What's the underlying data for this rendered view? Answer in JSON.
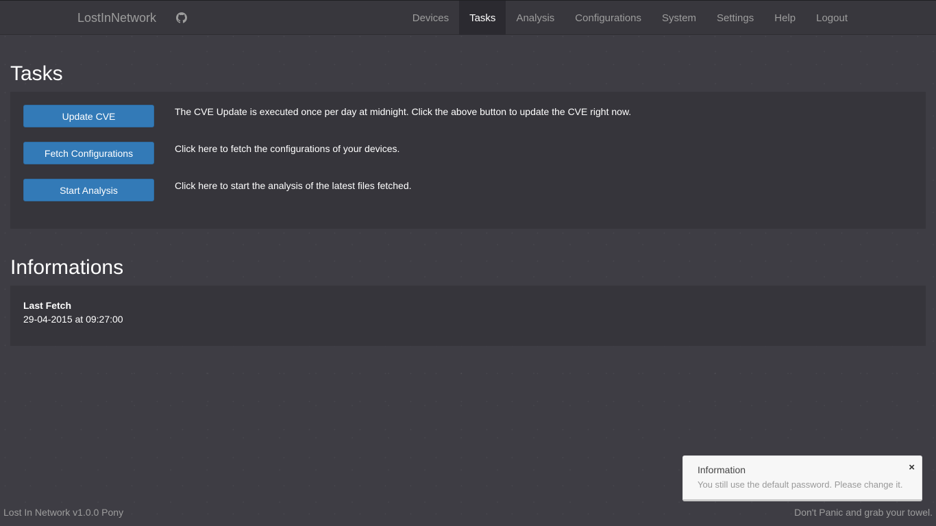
{
  "header": {
    "brand": "LostInNetwork",
    "nav": [
      {
        "label": "Devices",
        "active": false
      },
      {
        "label": "Tasks",
        "active": true
      },
      {
        "label": "Analysis",
        "active": false
      },
      {
        "label": "Configurations",
        "active": false
      },
      {
        "label": "System",
        "active": false
      },
      {
        "label": "Settings",
        "active": false
      },
      {
        "label": "Help",
        "active": false
      },
      {
        "label": "Logout",
        "active": false
      }
    ],
    "github_icon": "github-icon"
  },
  "tasks": {
    "title": "Tasks",
    "items": [
      {
        "button": "Update CVE",
        "description": "The CVE Update is executed once per day at midnight. Click the above button to update the CVE right now."
      },
      {
        "button": "Fetch Configurations",
        "description": "Click here to fetch the configurations of your devices."
      },
      {
        "button": "Start Analysis",
        "description": "Click here to start the analysis of the latest files fetched."
      }
    ]
  },
  "informations": {
    "title": "Informations",
    "last_fetch_label": "Last Fetch",
    "last_fetch_value": "29-04-2015 at 09:27:00"
  },
  "notification": {
    "title": "Information",
    "message": "You still use the default password. Please change it.",
    "close": "×"
  },
  "footer": {
    "left": "Lost In Network v1.0.0 Pony",
    "right": "Don't Panic and grab your towel."
  },
  "colors": {
    "background": "#3e3d44",
    "navbar": "#38373d",
    "primary_button": "#337ab7",
    "panel": "#36353b"
  }
}
